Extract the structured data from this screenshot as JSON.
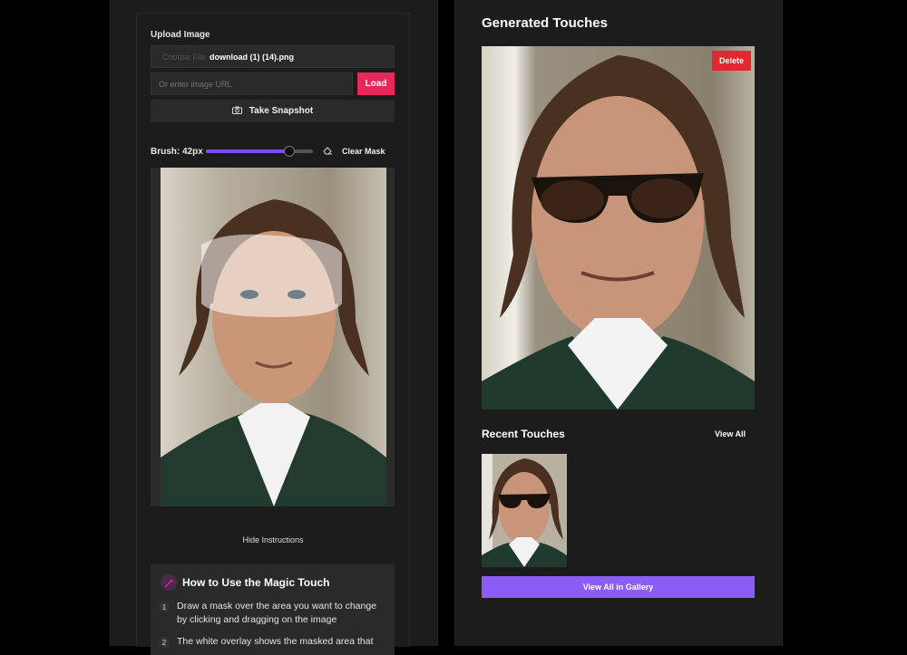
{
  "upload": {
    "label": "Upload Image",
    "choose_file": "Choose File",
    "file_name": "download (1) (14).png",
    "url_placeholder": "Or enter image URL",
    "load_label": "Load",
    "snapshot_label": "Take Snapshot"
  },
  "brush": {
    "label": "Brush: 42px",
    "value": 42,
    "level": 0.78,
    "clear_label": "Clear Mask"
  },
  "instructions": {
    "toggle_label": "Hide Instructions",
    "title": "How to Use the Magic Touch",
    "steps": [
      {
        "num": "1",
        "text": "Draw a mask over the area you want to change by clicking and dragging on the image"
      },
      {
        "num": "2",
        "text": "The white overlay shows the masked area that"
      }
    ]
  },
  "generated": {
    "title": "Generated Touches",
    "delete_label": "Delete"
  },
  "recent": {
    "title": "Recent Touches",
    "view_all_label": "View All",
    "gallery_label": "View All in Gallery"
  },
  "colors": {
    "accent_pink": "#e8275a",
    "accent_purple": "#8b5cf6",
    "delete_red": "#e0282e",
    "panel_bg": "#1c1c1c"
  }
}
